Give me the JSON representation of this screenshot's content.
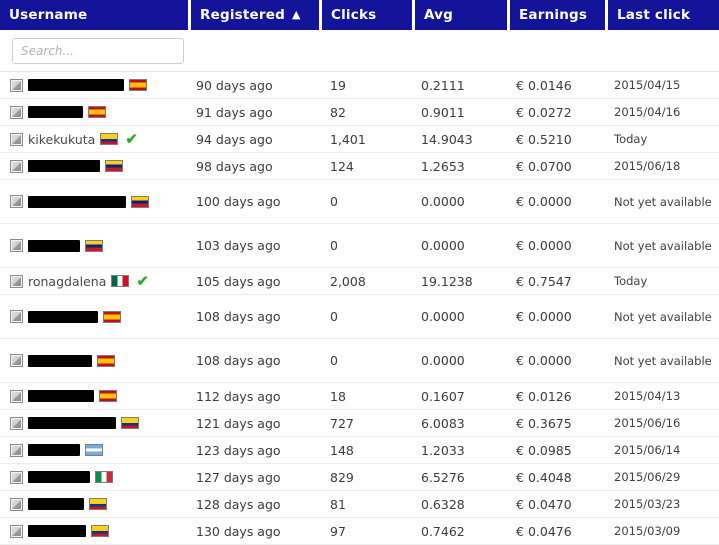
{
  "table": {
    "columns": [
      {
        "key": "username",
        "label": "Username",
        "sorted": false,
        "sort_dir": ""
      },
      {
        "key": "registered",
        "label": "Registered",
        "sorted": true,
        "sort_dir": "asc",
        "sort_caret": "▲"
      },
      {
        "key": "clicks",
        "label": "Clicks",
        "sorted": false,
        "sort_dir": ""
      },
      {
        "key": "avg",
        "label": "Avg",
        "sorted": false,
        "sort_dir": ""
      },
      {
        "key": "earnings",
        "label": "Earnings",
        "sorted": false,
        "sort_dir": ""
      },
      {
        "key": "last_click",
        "label": "Last click",
        "sorted": false,
        "sort_dir": ""
      }
    ],
    "header_bg": "#14149b",
    "header_fg": "#ffffff",
    "row_divider": "#ededed",
    "check_color": "#22aa22",
    "currency_symbol": "€",
    "search": {
      "value": "",
      "placeholder": "Search..."
    },
    "rows": [
      {
        "avatar_icon": "avatar-thumb-icon",
        "username": "",
        "username_redacted": true,
        "redacted_width": 96,
        "flag": "es",
        "flag_name": "flag-spain",
        "verified": false,
        "registered": "90 days ago",
        "clicks": "19",
        "avg": "0.2111",
        "earnings": "0.0146",
        "last_click": "2015/04/15"
      },
      {
        "avatar_icon": "avatar-thumb-icon",
        "username": "",
        "username_redacted": true,
        "redacted_width": 55,
        "flag": "es",
        "flag_name": "flag-spain",
        "verified": false,
        "registered": "91 days ago",
        "clicks": "82",
        "avg": "0.9011",
        "earnings": "0.0272",
        "last_click": "2015/04/16"
      },
      {
        "avatar_icon": "avatar-thumb-icon",
        "username": "kikekukuta",
        "username_redacted": false,
        "redacted_width": 0,
        "flag": "co",
        "flag_name": "flag-colombia",
        "verified": true,
        "registered": "94 days ago",
        "clicks": "1,401",
        "avg": "14.9043",
        "earnings": "0.5210",
        "last_click": "Today"
      },
      {
        "avatar_icon": "avatar-thumb-icon",
        "username": "",
        "username_redacted": true,
        "redacted_width": 72,
        "flag": "ve",
        "flag_name": "flag-venezuela",
        "verified": false,
        "registered": "98 days ago",
        "clicks": "124",
        "avg": "1.2653",
        "earnings": "0.0700",
        "last_click": "2015/06/18"
      },
      {
        "avatar_icon": "avatar-thumb-icon",
        "username": "",
        "username_redacted": true,
        "redacted_width": 98,
        "flag": "ve",
        "flag_name": "flag-venezuela",
        "verified": false,
        "registered": "100 days ago",
        "clicks": "0",
        "avg": "0.0000",
        "earnings": "0.0000",
        "last_click": "Not yet available"
      },
      {
        "avatar_icon": "avatar-thumb-icon",
        "username": "",
        "username_redacted": true,
        "redacted_width": 52,
        "flag": "ve",
        "flag_name": "flag-venezuela",
        "verified": false,
        "registered": "103 days ago",
        "clicks": "0",
        "avg": "0.0000",
        "earnings": "0.0000",
        "last_click": "Not yet available"
      },
      {
        "avatar_icon": "avatar-thumb-icon",
        "username": "ronagdalena",
        "username_redacted": false,
        "redacted_width": 0,
        "flag": "mx",
        "flag_name": "flag-mexico",
        "verified": true,
        "registered": "105 days ago",
        "clicks": "2,008",
        "avg": "19.1238",
        "earnings": "0.7547",
        "last_click": "Today"
      },
      {
        "avatar_icon": "avatar-thumb-icon",
        "username": "",
        "username_redacted": true,
        "redacted_width": 70,
        "flag": "es",
        "flag_name": "flag-spain",
        "verified": false,
        "registered": "108 days ago",
        "clicks": "0",
        "avg": "0.0000",
        "earnings": "0.0000",
        "last_click": "Not yet available"
      },
      {
        "avatar_icon": "avatar-thumb-icon",
        "username": "",
        "username_redacted": true,
        "redacted_width": 64,
        "flag": "es",
        "flag_name": "flag-spain",
        "verified": false,
        "registered": "108 days ago",
        "clicks": "0",
        "avg": "0.0000",
        "earnings": "0.0000",
        "last_click": "Not yet available"
      },
      {
        "avatar_icon": "avatar-thumb-icon",
        "username": "",
        "username_redacted": true,
        "redacted_width": 66,
        "flag": "es",
        "flag_name": "flag-spain",
        "verified": false,
        "registered": "112 days ago",
        "clicks": "18",
        "avg": "0.1607",
        "earnings": "0.0126",
        "last_click": "2015/04/13"
      },
      {
        "avatar_icon": "avatar-thumb-icon",
        "username": "",
        "username_redacted": true,
        "redacted_width": 88,
        "flag": "co",
        "flag_name": "flag-colombia",
        "verified": false,
        "registered": "121 days ago",
        "clicks": "727",
        "avg": "6.0083",
        "earnings": "0.3675",
        "last_click": "2015/06/16"
      },
      {
        "avatar_icon": "avatar-thumb-icon",
        "username": "",
        "username_redacted": true,
        "redacted_width": 52,
        "flag": "ar",
        "flag_name": "flag-argentina",
        "verified": false,
        "registered": "123 days ago",
        "clicks": "148",
        "avg": "1.2033",
        "earnings": "0.0985",
        "last_click": "2015/06/14"
      },
      {
        "avatar_icon": "avatar-thumb-icon",
        "username": "",
        "username_redacted": true,
        "redacted_width": 62,
        "flag": "it",
        "flag_name": "flag-italy",
        "verified": false,
        "registered": "127 days ago",
        "clicks": "829",
        "avg": "6.5276",
        "earnings": "0.4048",
        "last_click": "2015/06/29"
      },
      {
        "avatar_icon": "avatar-thumb-icon",
        "username": "",
        "username_redacted": true,
        "redacted_width": 56,
        "flag": "co",
        "flag_name": "flag-colombia",
        "verified": false,
        "registered": "128 days ago",
        "clicks": "81",
        "avg": "0.6328",
        "earnings": "0.0470",
        "last_click": "2015/03/23"
      },
      {
        "avatar_icon": "avatar-thumb-icon",
        "username": "",
        "username_redacted": true,
        "redacted_width": 58,
        "flag": "co",
        "flag_name": "flag-colombia",
        "verified": false,
        "registered": "130 days ago",
        "clicks": "97",
        "avg": "0.7462",
        "earnings": "0.0476",
        "last_click": "2015/03/09"
      }
    ]
  }
}
